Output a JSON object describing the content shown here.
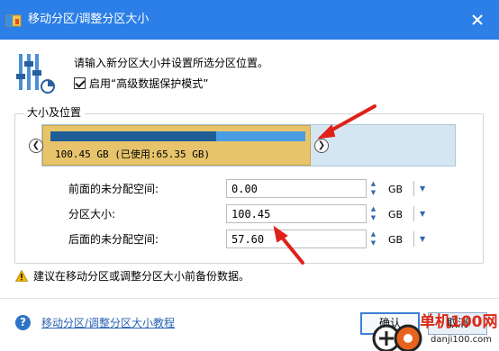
{
  "window": {
    "title": "移动分区/调整分区大小",
    "close_icon": "close-icon",
    "accent_color": "#2b7fe6"
  },
  "header": {
    "prompt": "请输入新分区大小并设置所选分区位置。",
    "checkbox_checked": true,
    "checkbox_label": "启用“高级数据保护模式”"
  },
  "size_group": {
    "legend": "大小及位置",
    "partition": {
      "label": "100.45 GB (已使用:65.35 GB)",
      "used_fraction": 0.65,
      "used_color": "#1f5d96",
      "free_color": "#4a9de4",
      "block_color": "#e7c46c",
      "unallocated_color": "#d4e6f2"
    },
    "fields": [
      {
        "label": "前面的未分配空间:",
        "value": "0.00",
        "unit": "GB"
      },
      {
        "label": "分区大小:",
        "value": "100.45",
        "unit": "GB"
      },
      {
        "label": "后面的未分配空间:",
        "value": "57.60",
        "unit": "GB"
      }
    ]
  },
  "warning": {
    "icon": "warning-icon",
    "text": "建议在移动分区或调整分区大小前备份数据。"
  },
  "footer": {
    "help_icon": "question-icon",
    "help_link": "移动分区/调整分区大小教程",
    "ok_label": "确认",
    "cancel_label": "取消"
  },
  "watermark": {
    "text": "单机100网",
    "url": "danji100.com"
  }
}
